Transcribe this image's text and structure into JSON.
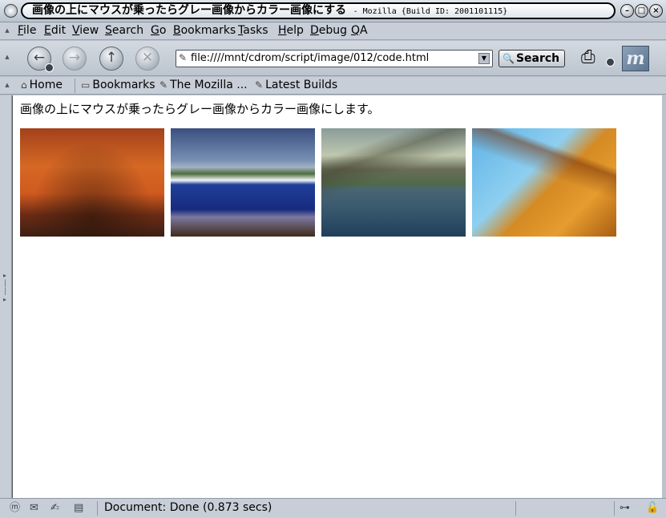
{
  "window": {
    "title": "画像の上にマウスが乗ったらグレー画像からカラー画像にする",
    "subtitle": "- Mozilla {Build ID: 2001101115}"
  },
  "menu": [
    "File",
    "Edit",
    "View",
    "Search",
    "Go",
    "Bookmarks",
    "Tasks",
    "Help",
    "Debug",
    "QA"
  ],
  "nav": {
    "url": "file:////mnt/cdrom/script/image/012/code.html",
    "search_label": "Search"
  },
  "personal_toolbar": {
    "home": "Home",
    "bookmarks": "Bookmarks",
    "mozilla": "The Mozilla ...",
    "latest_builds": "Latest Builds"
  },
  "content": {
    "heading": "画像の上にマウスが乗ったらグレー画像からカラー画像にします。"
  },
  "status": {
    "text": "Document: Done (0.873 secs)"
  }
}
